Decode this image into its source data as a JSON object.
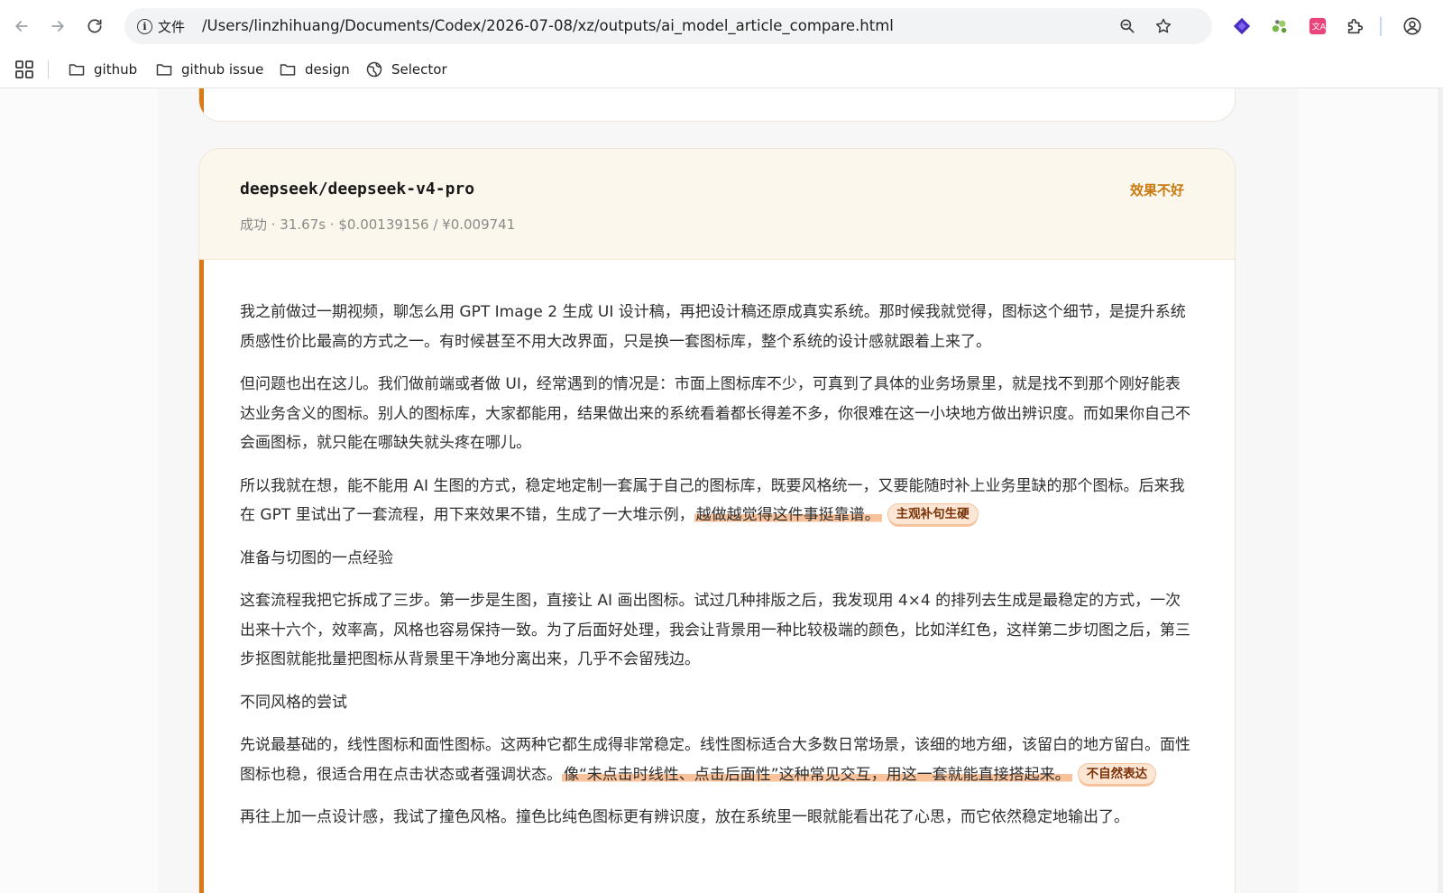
{
  "browser": {
    "site_label": "文件",
    "url": "/Users/linzhihuang/Documents/Codex/2026-07-08/xz/outputs/ai_model_article_compare.html",
    "bookmarks": [
      {
        "label": "github",
        "icon": "folder-icon"
      },
      {
        "label": "github issue",
        "icon": "folder-icon"
      },
      {
        "label": "design",
        "icon": "folder-icon"
      },
      {
        "label": "Selector",
        "icon": "globe-icon"
      }
    ]
  },
  "card": {
    "model": "deepseek/deepseek-v4-pro",
    "meta": "成功 · 31.67s · $0.00139156 / ¥0.009741",
    "verdict": "效果不好",
    "paragraphs": {
      "p1": "我之前做过一期视频，聊怎么用 GPT Image 2 生成 UI 设计稿，再把设计稿还原成真实系统。那时候我就觉得，图标这个细节，是提升系统质感性价比最高的方式之一。有时候甚至不用大改界面，只是换一套图标库，整个系统的设计感就跟着上来了。",
      "p2": "但问题也出在这儿。我们做前端或者做 UI，经常遇到的情况是：市面上图标库不少，可真到了具体的业务场景里，就是找不到那个刚好能表达业务含义的图标。别人的图标库，大家都能用，结果做出来的系统看着都长得差不多，你很难在这一小块地方做出辨识度。而如果你自己不会画图标，就只能在哪缺失就头疼在哪儿。",
      "p3_text": "所以我就在想，能不能用 AI 生图的方式，稳定地定制一套属于自己的图标库，既要风格统一，又要能随时补上业务里缺的那个图标。后来我在 GPT 里试出了一套流程，用下来效果不错，生成了一大堆示例，",
      "p3_highlight": "越做越觉得这件事挺靠谱。",
      "p3_tag": "主观补句生硬",
      "h1": "准备与切图的一点经验",
      "p4": "这套流程我把它拆成了三步。第一步是生图，直接让 AI 画出图标。试过几种排版之后，我发现用 4×4 的排列去生成是最稳定的方式，一次出来十六个，效率高，风格也容易保持一致。为了后面好处理，我会让背景用一种比较极端的颜色，比如洋红色，这样第二步切图之后，第三步抠图就能批量把图标从背景里干净地分离出来，几乎不会留残边。",
      "h2": "不同风格的尝试",
      "p5_text": "先说最基础的，线性图标和面性图标。这两种它都生成得非常稳定。线性图标适合大多数日常场景，该细的地方细，该留白的地方留白。面性图标也稳，很适合用在点击状态或者强调状态。",
      "p5_highlight": "像“未点击时线性、点击后面性”这种常见交互，用这一套就能直接搭起来。",
      "p5_tag": "不自然表达",
      "p6": "再往上加一点设计感，我试了撞色风格。撞色比纯色图标更有辨识度，放在系统里一眼就能看出花了心思，而它依然稳定地输出了。"
    }
  },
  "colors": {
    "accent": "#d97a12",
    "verdict": "#c8790f",
    "highlight": "#f9c29a",
    "tag_bg": "#fde6d3",
    "header_bg": "#fcf7ec"
  }
}
